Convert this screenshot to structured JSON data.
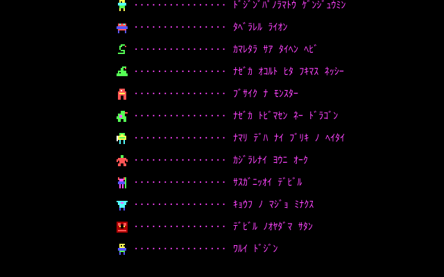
{
  "colors": {
    "background": "#000000",
    "text": "#ff44ff"
  },
  "monsters": [
    {
      "icon": "skeleton-warrior-icon",
      "leader": "················",
      "name": "ﾄﾞｼﾞﾝﾞﾊﾟﾉﾗﾏﾄｳ ｹﾞﾝｼﾞｭｳﾐﾝ"
    },
    {
      "icon": "beast-icon",
      "leader": "················",
      "name": "ﾀﾍﾞﾗﾚﾙ ﾗｲｵﾝ"
    },
    {
      "icon": "snake-icon",
      "leader": "················",
      "name": "ｶﾏﾚﾀﾗ ｻｱ ﾀｲﾍﾝ ﾍﾋﾞ"
    },
    {
      "icon": "sea-serpent-icon",
      "leader": "················",
      "name": "ﾅｾﾞｶ ｵｺﾙﾄ ﾋﾀ ﾌｷﾏｽ ﾈｯｼｰ"
    },
    {
      "icon": "monster-icon",
      "leader": "················",
      "name": "ﾌﾞｻｲｸ ﾅ ﾓﾝｽﾀｰ"
    },
    {
      "icon": "dragon-icon",
      "leader": "················",
      "name": "ﾅｾﾞｶ ﾄﾋﾞﾏｾﾝ ﾈｰ ﾄﾞﾗｺﾞﾝ"
    },
    {
      "icon": "knight-icon",
      "leader": "················",
      "name": "ﾅﾏﾘ ﾃﾞﾊ ﾅｲ ﾌﾞﾘｷ ﾉ ﾍｲﾀｲ"
    },
    {
      "icon": "orc-icon",
      "leader": "················",
      "name": "ｶｼﾞﾗﾚﾅｲ ﾖｳﾆ ｵｰｸ"
    },
    {
      "icon": "devil-icon",
      "leader": "················",
      "name": "ｻｽｶﾞﾆｯｵｲ ﾃﾞﾋﾞﾙ"
    },
    {
      "icon": "witch-icon",
      "leader": "················",
      "name": "ｷｮｳﾌ ﾉ ﾏｼﾞｮ ﾐﾅｸｽ"
    },
    {
      "icon": "satan-icon",
      "leader": "················",
      "name": "ﾃﾞﾋﾞﾙ ﾉｵﾔﾀﾞﾏ ｻﾀﾝ"
    },
    {
      "icon": "villain-icon",
      "leader": "················",
      "name": "ﾜﾙｲ ﾄﾞｼﾞﾝ"
    }
  ]
}
